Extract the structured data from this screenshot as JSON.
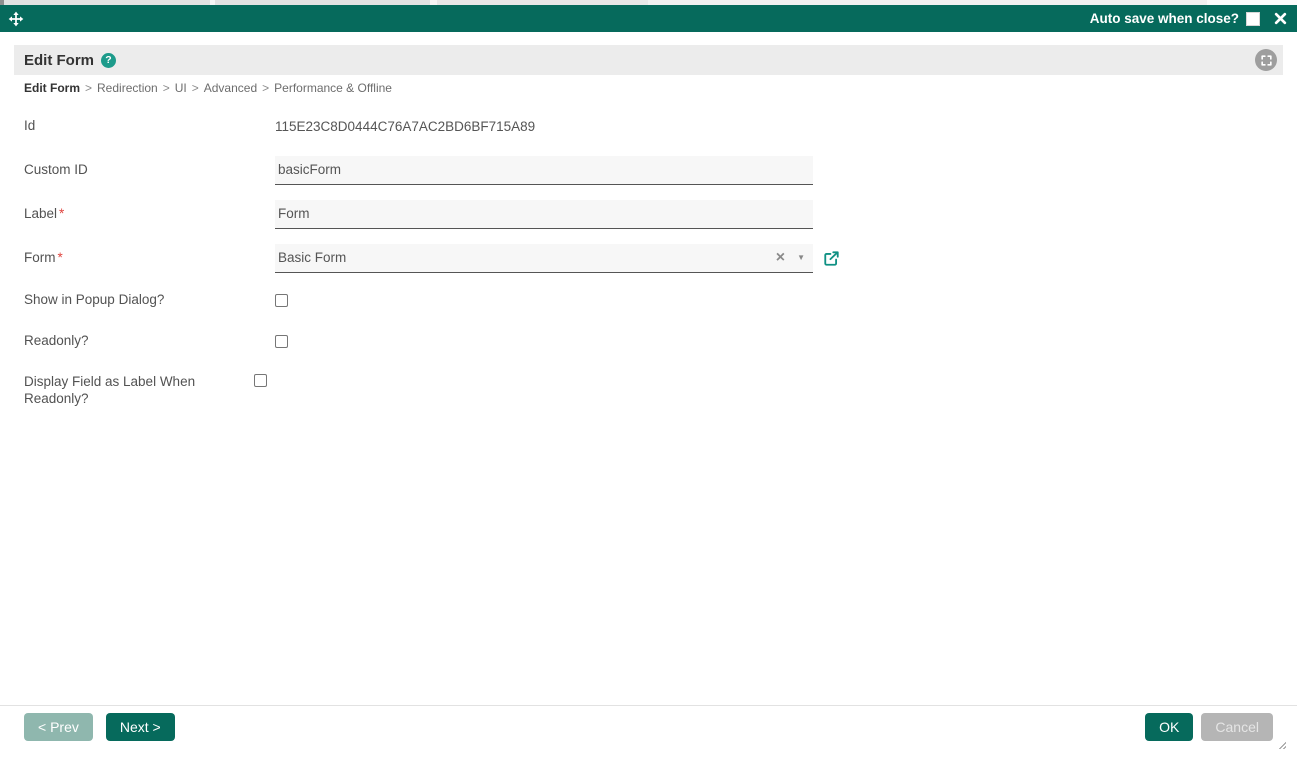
{
  "colors": {
    "accent_teal": "#066a5c",
    "help_icon_teal": "#1d9b8b",
    "external_link_teal": "#0f9184",
    "prev_button_sage": "#8fb7ae",
    "cancel_button_gray": "#b5b5b5",
    "required_red": "#e0443e",
    "header_strip_gray": "#ececec",
    "input_background": "#f7f7f7"
  },
  "titlebar": {
    "auto_save_label": "Auto save when close?",
    "auto_save_checked": false,
    "move_icon": "move-arrows-icon",
    "close_icon": "close-x-icon"
  },
  "panel": {
    "title": "Edit Form",
    "help_icon_glyph": "?",
    "fullscreen_icon": "expand-corners-icon"
  },
  "breadcrumb": {
    "current": "Edit Form",
    "separator": ">",
    "items": [
      "Redirection",
      "UI",
      "Advanced",
      "Performance & Offline"
    ]
  },
  "fields": {
    "id": {
      "label": "Id",
      "value": "115E23C8D0444C76A7AC2BD6BF715A89"
    },
    "custom_id": {
      "label": "Custom ID",
      "value": "basicForm"
    },
    "label": {
      "label": "Label",
      "required_mark": "*",
      "value": "Form"
    },
    "form": {
      "label": "Form",
      "required_mark": "*",
      "value": "Basic Form",
      "clear_icon_glyph": "×",
      "caret_icon_glyph": "▼"
    },
    "show_in_popup": {
      "label": "Show in Popup Dialog?",
      "checked": false
    },
    "readonly": {
      "label": "Readonly?",
      "checked": false
    },
    "display_field_as_label": {
      "label": "Display Field as Label When Readonly?",
      "checked": false
    }
  },
  "footer": {
    "prev": "< Prev",
    "next": "Next >",
    "ok": "OK",
    "cancel": "Cancel"
  }
}
